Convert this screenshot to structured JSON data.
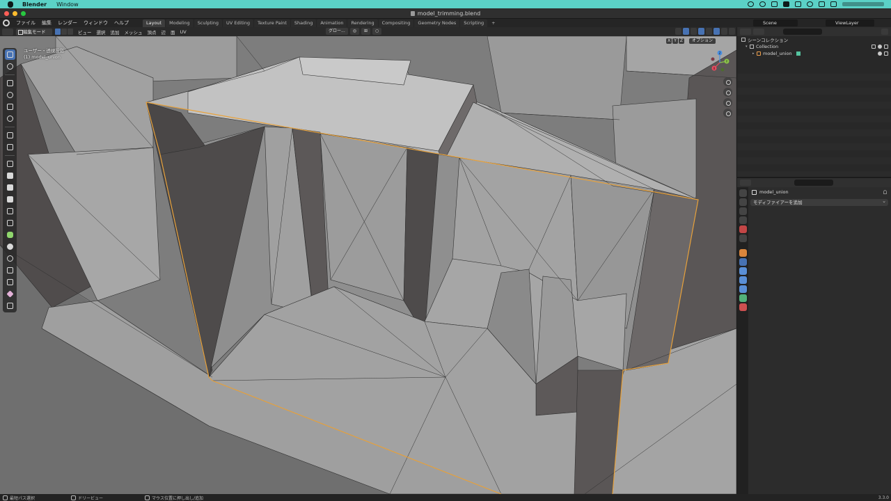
{
  "macbar": {
    "app_name": "Blender",
    "menus": [
      "Window"
    ]
  },
  "window": {
    "title": "model_trimming.blend"
  },
  "topbar": {
    "menus": [
      "ファイル",
      "編集",
      "レンダー",
      "ウィンドウ",
      "ヘルプ"
    ],
    "workspace_tabs": [
      "Layout",
      "Modeling",
      "Sculpting",
      "UV Editing",
      "Texture Paint",
      "Shading",
      "Animation",
      "Rendering",
      "Compositing",
      "Geometry Nodes",
      "Scripting"
    ],
    "active_workspace": "Layout",
    "add_tab": "+",
    "scene": "Scene",
    "view_layer": "ViewLayer"
  },
  "viewport_header": {
    "mode": "編集モード",
    "menus": [
      "ビュー",
      "選択",
      "追加",
      "メッシュ",
      "頂点",
      "辺",
      "面",
      "UV"
    ],
    "transform_orientation": "グロー...",
    "axis_labels": [
      "X",
      "Y",
      "Z"
    ],
    "options_label": "オプション"
  },
  "viewport": {
    "view_name": "ユーザー・透視投影",
    "object_info": "(1) model_union",
    "gizmo_axes": {
      "x": "X",
      "y": "Y",
      "z": "Z"
    },
    "colors": {
      "background": "#7a7a7a",
      "face_light": "#a9a9a9",
      "face_mid": "#8f8f8f",
      "face_dark": "#4c4a4a",
      "selection_edge": "#e8a23c",
      "wire": "#2a2a2a"
    }
  },
  "outliner": {
    "rows": [
      {
        "label": "シーンコレクション",
        "icon": "scene-collection-icon"
      },
      {
        "label": "Collection",
        "icon": "collection-icon"
      },
      {
        "label": "model_union",
        "icon": "mesh-object-icon"
      }
    ]
  },
  "properties": {
    "object_name": "model_union",
    "add_modifier": "モディファイアーを追加",
    "active_tab": "modifier-wrench-icon"
  },
  "statusbar": {
    "items": [
      "最短パス選択",
      "ドリービュー",
      "マウス位置に押し出し/追加"
    ],
    "version": "3.3.0"
  }
}
